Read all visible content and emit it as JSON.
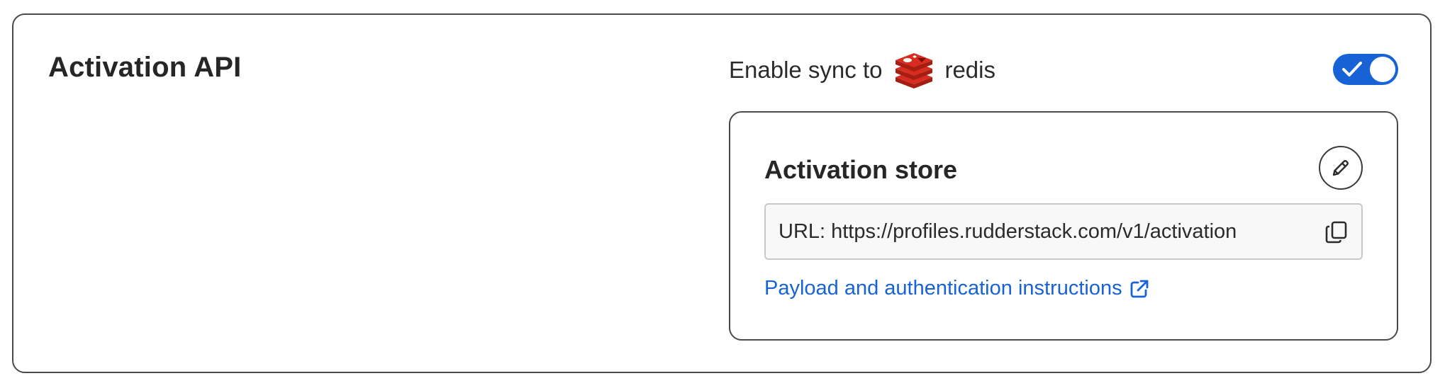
{
  "section": {
    "title": "Activation API"
  },
  "sync": {
    "label": "Enable sync to",
    "destination": "redis",
    "destination_icon": "redis-logo-icon",
    "enabled": true,
    "toggle_color": "#1763d6"
  },
  "activation_store": {
    "title": "Activation store",
    "edit_icon": "pencil-icon",
    "url_label": "URL:",
    "url_value": "https://profiles.rudderstack.com/v1/activation",
    "copy_icon": "copy-icon",
    "link_text": "Payload and authentication instructions",
    "link_icon": "external-link-icon",
    "link_color": "#1763d6"
  }
}
